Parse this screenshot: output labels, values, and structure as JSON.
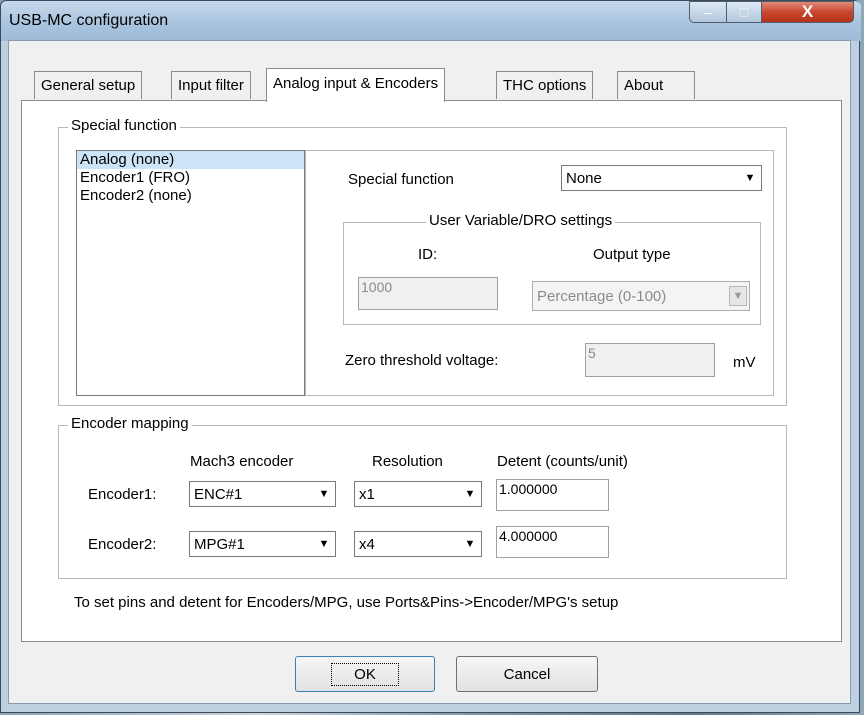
{
  "window": {
    "title": "USB-MC configuration",
    "controls": {
      "minimize": "–",
      "maximize": "□",
      "close": "X"
    }
  },
  "tabs": [
    {
      "label": "General setup"
    },
    {
      "label": "Input filter"
    },
    {
      "label": "Analog input & Encoders"
    },
    {
      "label": "THC options"
    },
    {
      "label": "About"
    }
  ],
  "active_tab": "Analog input & Encoders",
  "special_function": {
    "group_title": "Special function",
    "list": [
      {
        "label": "Analog (none)",
        "selected": true
      },
      {
        "label": "Encoder1 (FRO)",
        "selected": false
      },
      {
        "label": "Encoder2 (none)",
        "selected": false
      }
    ],
    "field_label": "Special function",
    "field_value": "None",
    "user_var": {
      "group_title": "User Variable/DRO settings",
      "id_label": "ID:",
      "id_value": "1000",
      "output_type_label": "Output type",
      "output_type_value": "Percentage (0-100)"
    },
    "zero_threshold_label": "Zero threshold voltage:",
    "zero_threshold_value": "5",
    "zero_threshold_unit": "mV"
  },
  "encoder_mapping": {
    "group_title": "Encoder mapping",
    "headers": {
      "mach3_encoder": "Mach3 encoder",
      "resolution": "Resolution",
      "detent": "Detent (counts/unit)"
    },
    "rows": [
      {
        "label": "Encoder1:",
        "mach3_encoder": "ENC#1",
        "resolution": "x1",
        "detent": "1.000000"
      },
      {
        "label": "Encoder2:",
        "mach3_encoder": "MPG#1",
        "resolution": "x4",
        "detent": "4.000000"
      }
    ]
  },
  "note": "To set pins and detent for Encoders/MPG, use Ports&Pins->Encoder/MPG's setup",
  "buttons": {
    "ok": "OK",
    "cancel": "Cancel"
  },
  "icons": {
    "dropdown": "▼"
  },
  "colors": {
    "selection": "#cce4f7",
    "close_button": "#c7472f",
    "titlebar": "#a9c4de"
  }
}
